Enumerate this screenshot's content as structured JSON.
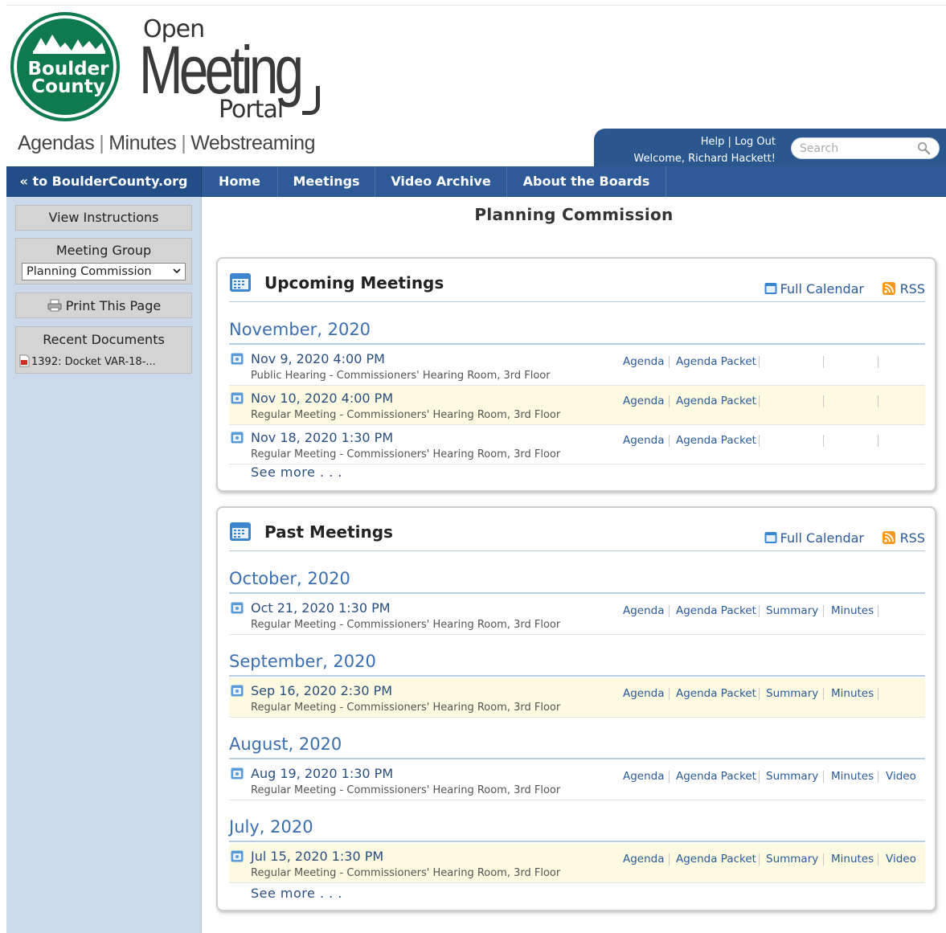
{
  "header": {
    "logo_line1": "Boulder",
    "logo_line2": "County",
    "portal_open": "Open",
    "portal_meeting": "Meeting",
    "portal_portal": "Portal",
    "tagline_agendas": "Agendas",
    "tagline_minutes": "Minutes",
    "tagline_webstreaming": "Webstreaming",
    "sep": "|"
  },
  "userbox": {
    "help": "Help",
    "sep": " | ",
    "logout": "Log Out",
    "welcome": "Welcome, Richard Hackett!",
    "search_placeholder": "Search"
  },
  "nav": {
    "back": "« to BoulderCounty.org",
    "home": "Home",
    "meetings": "Meetings",
    "video_archive": "Video Archive",
    "about": "About the Boards"
  },
  "sidebar": {
    "instructions": "View Instructions",
    "group_title": "Meeting Group",
    "group_selected": "Planning Commission",
    "print": "Print This Page",
    "recent_title": "Recent Documents",
    "recent_doc": "1392: Docket VAR-18-..."
  },
  "page_title": "Planning Commission",
  "upcoming": {
    "title": "Upcoming Meetings",
    "full_calendar": "Full Calendar",
    "rss": "RSS",
    "month": "November, 2020",
    "meetings": [
      {
        "date": "Nov 9, 2020 4:00 PM",
        "desc": "Public Hearing - Commissioners' Hearing Room, 3rd Floor",
        "agenda": "Agenda",
        "packet": "Agenda Packet"
      },
      {
        "date": "Nov 10, 2020 4:00 PM",
        "desc": "Regular Meeting - Commissioners' Hearing Room, 3rd Floor",
        "agenda": "Agenda",
        "packet": "Agenda Packet"
      },
      {
        "date": "Nov 18, 2020 1:30 PM",
        "desc": "Regular Meeting - Commissioners' Hearing Room, 3rd Floor",
        "agenda": "Agenda",
        "packet": "Agenda Packet"
      }
    ],
    "see_more": "See more . . ."
  },
  "past": {
    "title": "Past Meetings",
    "full_calendar": "Full Calendar",
    "rss": "RSS",
    "months": [
      "October, 2020",
      "September, 2020",
      "August, 2020",
      "July, 2020"
    ],
    "meetings": [
      {
        "date": "Oct 21, 2020 1:30 PM",
        "desc": "Regular Meeting - Commissioners' Hearing Room, 3rd Floor",
        "agenda": "Agenda",
        "packet": "Agenda Packet",
        "summary": "Summary",
        "minutes": "Minutes",
        "video": ""
      },
      {
        "date": "Sep 16, 2020 2:30 PM",
        "desc": "Regular Meeting - Commissioners' Hearing Room, 3rd Floor",
        "agenda": "Agenda",
        "packet": "Agenda Packet",
        "summary": "Summary",
        "minutes": "Minutes",
        "video": ""
      },
      {
        "date": "Aug 19, 2020 1:30 PM",
        "desc": "Regular Meeting - Commissioners' Hearing Room, 3rd Floor",
        "agenda": "Agenda",
        "packet": "Agenda Packet",
        "summary": "Summary",
        "minutes": "Minutes",
        "video": "Video"
      },
      {
        "date": "Jul 15, 2020 1:30 PM",
        "desc": "Regular Meeting - Commissioners' Hearing Room, 3rd Floor",
        "agenda": "Agenda",
        "packet": "Agenda Packet",
        "summary": "Summary",
        "minutes": "Minutes",
        "video": "Video"
      }
    ],
    "see_more": "See more . . ."
  },
  "colors": {
    "nav_blue": "#2e5b97",
    "logo_green": "#0f7a4e",
    "link_blue": "#2a5a99",
    "month_blue": "#3a6eb0",
    "row_highlight": "#fcfae0",
    "sidebar_bg": "#ccd9ea"
  },
  "icons": {
    "calendar": "calendar-icon",
    "rss": "rss-icon",
    "search": "search-icon",
    "print": "printer-icon",
    "pdf": "pdf-icon"
  }
}
